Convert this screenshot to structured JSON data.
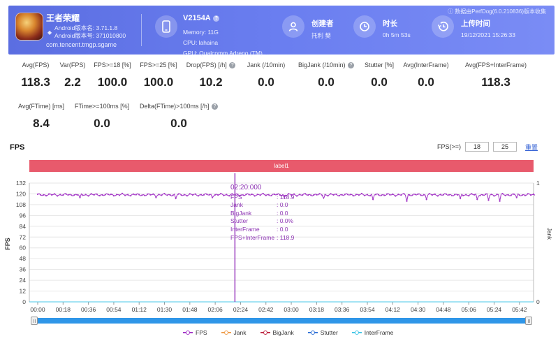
{
  "header": {
    "app_name": "王者荣耀",
    "android_version": "Android版本名: 3.71.1.8",
    "android_code": "Android版本号: 371010800",
    "package": "com.tencent.tmgp.sgame",
    "device_name": "V2154A",
    "device_memory": "Memory: 11G",
    "device_cpu": "CPU: lahaina",
    "device_gpu": "GPU: Qualcomm Adreno (TM) ...",
    "creator_label": "创建者",
    "creator_value": "托利 樊",
    "duration_label": "时长",
    "duration_value": "0h 5m 53s",
    "upload_label": "上传时间",
    "upload_value": "19/12/2021 15:26:33",
    "source_note": "ⓘ 数据由PerfDog(6.0.210836)版本收集"
  },
  "stats_row1": [
    {
      "label": "Avg(FPS)",
      "value": "118.3"
    },
    {
      "label": "Var(FPS)",
      "value": "2.2"
    },
    {
      "label": "FPS>=18 [%]",
      "value": "100.0"
    },
    {
      "label": "FPS>=25 [%]",
      "value": "100.0"
    },
    {
      "label": "Drop(FPS) [/h]",
      "value": "10.2"
    },
    {
      "label": "Jank (/10min)",
      "value": "0.0"
    },
    {
      "label": "BigJank (/10min)",
      "value": "0.0"
    },
    {
      "label": "Stutter [%]",
      "value": "0.0"
    },
    {
      "label": "Avg(InterFrame)",
      "value": "0.0"
    },
    {
      "label": "Avg(FPS+InterFrame)",
      "value": "118.3"
    }
  ],
  "stats_row2": [
    {
      "label": "Avg(FTime) [ms]",
      "value": "8.4"
    },
    {
      "label": "FTime>=100ms [%]",
      "value": "0.0"
    },
    {
      "label": "Delta(FTime)>100ms [/h]",
      "value": "0.0"
    }
  ],
  "chart_section": {
    "title": "FPS",
    "filter_label": "FPS(>=)",
    "filter_value_1": "18",
    "filter_value_2": "25",
    "reset_label": "重置",
    "label_bar": "label1",
    "y_title_left": "FPS",
    "y_title_right": "Jank"
  },
  "tooltip": {
    "time": "02:20:000",
    "rows": [
      {
        "k": "FPS",
        "v": ": 118.9"
      },
      {
        "k": "Jank",
        "v": ": 0.0"
      },
      {
        "k": "BigJank",
        "v": ": 0.0"
      },
      {
        "k": "Stutter",
        "v": ": 0.0%"
      },
      {
        "k": "InterFrame",
        "v": ": 0.0"
      },
      {
        "k": "FPS+InterFrame",
        "v": ": 118.9"
      }
    ]
  },
  "legend": [
    {
      "name": "FPS",
      "color": "#a63cc8"
    },
    {
      "name": "Jank",
      "color": "#f0a050"
    },
    {
      "name": "BigJank",
      "color": "#c0304a"
    },
    {
      "name": "Stutter",
      "color": "#3a78d8"
    },
    {
      "name": "InterFrame",
      "color": "#4ac8e8"
    }
  ],
  "chart_data": {
    "type": "line",
    "x_ticks": [
      "00:00",
      "00:18",
      "00:36",
      "00:54",
      "01:12",
      "01:30",
      "01:48",
      "02:06",
      "02:24",
      "02:42",
      "03:00",
      "03:18",
      "03:36",
      "03:54",
      "04:12",
      "04:30",
      "04:48",
      "05:06",
      "05:24",
      "05:42"
    ],
    "y_ticks": [
      0,
      12,
      24,
      36,
      48,
      60,
      72,
      84,
      96,
      108,
      120,
      132
    ],
    "ylim": [
      0,
      132
    ],
    "y2_ticks": [
      0,
      1
    ],
    "y2lim": [
      0,
      1
    ],
    "cursor_time_s": 140,
    "duration_s": 353,
    "series": [
      {
        "name": "FPS",
        "color": "#a63cc8",
        "base": 119,
        "dips": [
          [
            30,
            116
          ],
          [
            84,
            116
          ],
          [
            98,
            115
          ],
          [
            124,
            116
          ],
          [
            140,
            118.9
          ],
          [
            175,
            116
          ],
          [
            203,
            115
          ],
          [
            238,
            114
          ],
          [
            262,
            112
          ],
          [
            276,
            114
          ],
          [
            300,
            115
          ],
          [
            312,
            114
          ],
          [
            320,
            113
          ],
          [
            328,
            112
          ],
          [
            340,
            116
          ]
        ]
      },
      {
        "name": "Jank",
        "color": "#f0a050",
        "value": 0
      },
      {
        "name": "BigJank",
        "color": "#c0304a",
        "value": 0
      },
      {
        "name": "Stutter",
        "color": "#3a78d8",
        "value": 0
      },
      {
        "name": "InterFrame",
        "color": "#4ac8e8",
        "value": 0
      }
    ]
  }
}
